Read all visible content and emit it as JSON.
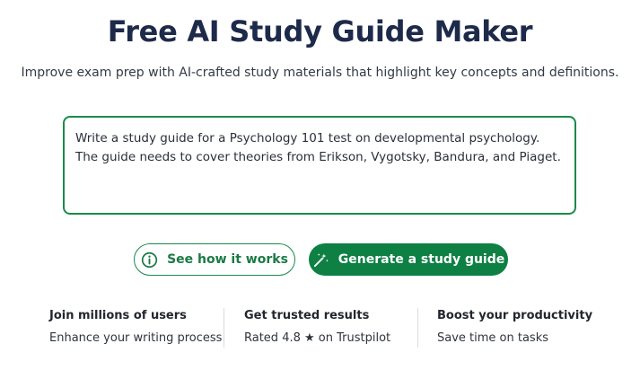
{
  "header": {
    "title": "Free AI Study Guide Maker",
    "subtitle": "Improve exam prep with AI-crafted study materials that highlight key concepts and definitions."
  },
  "prompt": {
    "text": "Write a study guide for a Psychology 101 test on developmental psychology. The guide needs to cover theories from Erikson, Vygotsky, Bandura, and Piaget."
  },
  "actions": {
    "see_how": {
      "label": "See how it works",
      "icon": "info-circle-icon"
    },
    "generate": {
      "label": "Generate a study guide",
      "icon": "magic-wand-icon"
    }
  },
  "features": [
    {
      "title": "Join millions of users",
      "description": "Enhance your writing process"
    },
    {
      "title": "Get trusted results",
      "description": "Rated 4.8 ★ on Trustpilot"
    },
    {
      "title": "Boost your productivity",
      "description": "Save time on tasks"
    }
  ],
  "colors": {
    "brand_green": "#0e8044",
    "title_navy": "#1e2a4a"
  }
}
